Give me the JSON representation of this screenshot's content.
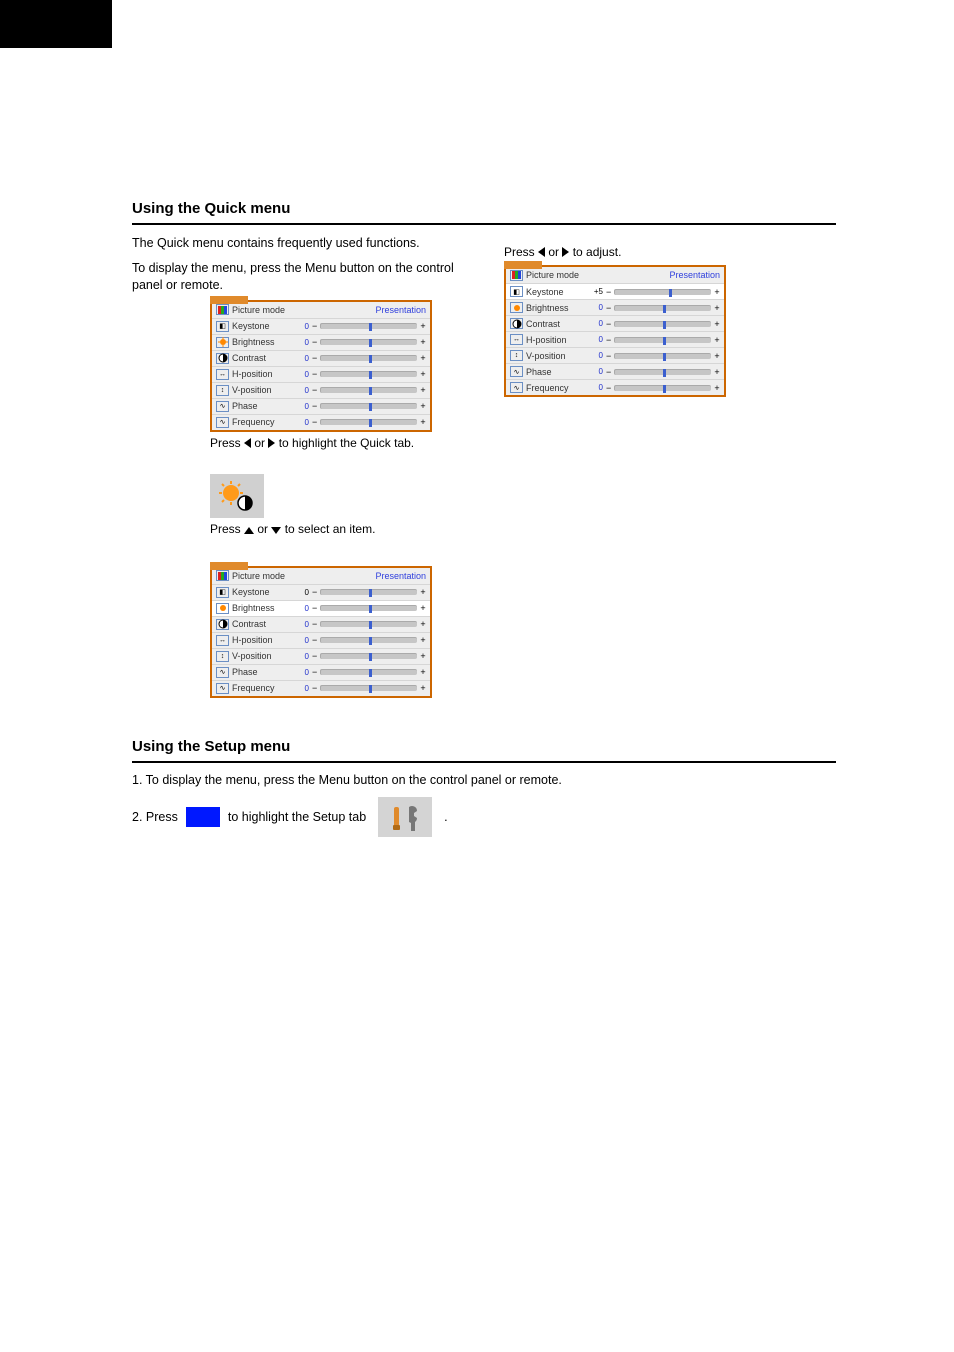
{
  "section1": {
    "title": "Using the Quick menu",
    "intro": "The Quick menu contains frequently used functions.",
    "open_menu": "To display the menu, press the Menu button on the control panel or remote.",
    "arrows_lr_1": "to highlight the Quick tab.",
    "arrows_ud": "to select an item.",
    "adjust": "to adjust.",
    "caption_lr": "Press ◀ or ▶",
    "caption_ud": "Press ▲ or ▼"
  },
  "section2": {
    "title": "Using the Setup menu",
    "step1": "1. To display the menu, press the Menu button on the control panel or remote.",
    "step2a": "2. Press",
    "step2b": "to highlight the Setup tab",
    "step2c": "."
  },
  "osd": {
    "mode_label": "Picture mode",
    "mode_value": "Presentation",
    "items": [
      {
        "icon": "keystone",
        "label": "Keystone",
        "value": "0"
      },
      {
        "icon": "brightness",
        "label": "Brightness",
        "value": "0"
      },
      {
        "icon": "contrast",
        "label": "Contrast",
        "value": "0"
      },
      {
        "icon": "hpos",
        "label": "H-position",
        "value": "0"
      },
      {
        "icon": "vpos",
        "label": "V-position",
        "value": "0"
      },
      {
        "icon": "phase",
        "label": "Phase",
        "value": "0"
      },
      {
        "icon": "freq",
        "label": "Frequency",
        "value": "0"
      }
    ],
    "items_adjusted": [
      {
        "icon": "keystone",
        "label": "Keystone",
        "value": "+5"
      },
      {
        "icon": "brightness",
        "label": "Brightness",
        "value": "0"
      },
      {
        "icon": "contrast",
        "label": "Contrast",
        "value": "0"
      },
      {
        "icon": "hpos",
        "label": "H-position",
        "value": "0"
      },
      {
        "icon": "vpos",
        "label": "V-position",
        "value": "0"
      },
      {
        "icon": "phase",
        "label": "Phase",
        "value": "0"
      },
      {
        "icon": "freq",
        "label": "Frequency",
        "value": "0"
      }
    ]
  },
  "icons": {
    "brightness_contrast": "brightness-contrast-icon",
    "advanced_setup": "screwdriver-wrench-icon"
  }
}
